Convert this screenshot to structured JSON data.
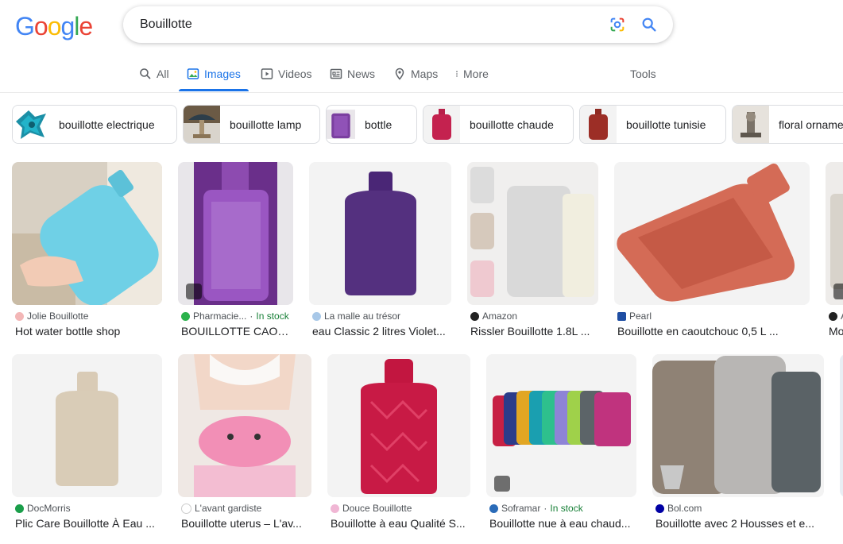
{
  "logo": {
    "letters": [
      "G",
      "o",
      "o",
      "g",
      "l",
      "e"
    ],
    "colors": [
      "#4285F4",
      "#EA4335",
      "#FBBC05",
      "#4285F4",
      "#34A853",
      "#EA4335"
    ]
  },
  "search": {
    "query": "Bouillotte"
  },
  "tabs": [
    {
      "label": "All",
      "icon": "search-icon"
    },
    {
      "label": "Images",
      "icon": "images-icon"
    },
    {
      "label": "Videos",
      "icon": "video-icon"
    },
    {
      "label": "News",
      "icon": "news-icon"
    },
    {
      "label": "Maps",
      "icon": "map-pin-icon"
    },
    {
      "label": "More",
      "icon": "more-vert-icon"
    }
  ],
  "tools": "Tools",
  "chips": [
    {
      "label": "bouillotte electrique"
    },
    {
      "label": "bouillotte lamp"
    },
    {
      "label": "bottle"
    },
    {
      "label": "bouillotte chaude"
    },
    {
      "label": "bouillotte tunisie"
    },
    {
      "label": "floral orname"
    }
  ],
  "row1": [
    {
      "source": "Jolie Bouillotte",
      "stock": "",
      "title": "Hot water bottle shop"
    },
    {
      "source": "Pharmacie...",
      "stock": "In stock",
      "title": "BOUILLOTTE CAOU..."
    },
    {
      "source": "La malle au trésor",
      "stock": "",
      "title": "eau Classic 2 litres Violet..."
    },
    {
      "source": "Amazon",
      "stock": "",
      "title": "Rissler Bouillotte 1.8L ..."
    },
    {
      "source": "Pearl",
      "stock": "",
      "title": "Bouillotte en caoutchouc 0,5 L ..."
    },
    {
      "source": "A",
      "stock": "",
      "title": "Mo"
    }
  ],
  "row2": [
    {
      "source": "DocMorris",
      "stock": "",
      "title": "Plic Care Bouillotte À Eau ..."
    },
    {
      "source": "L'avant gardiste",
      "stock": "",
      "title": "Bouillotte uterus – L'av..."
    },
    {
      "source": "Douce Bouillotte",
      "stock": "",
      "title": "Bouillotte à eau Qualité S..."
    },
    {
      "source": "Soframar",
      "stock": "In stock",
      "title": "Bouillotte nue à eau chaud..."
    },
    {
      "source": "Bol.com",
      "stock": "",
      "title": "Bouillotte avec 2 Housses et e..."
    }
  ]
}
